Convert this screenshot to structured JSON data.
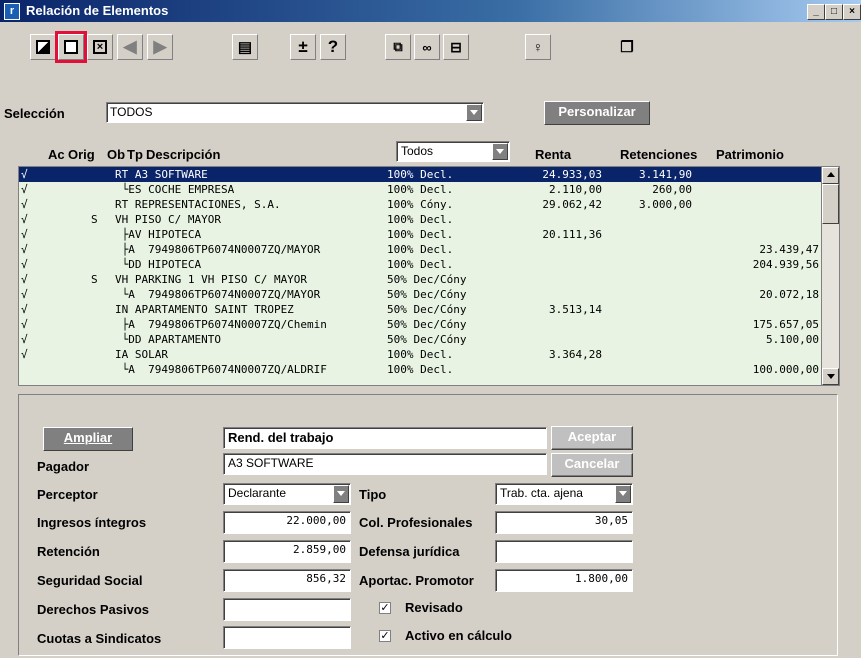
{
  "window": {
    "title": "Relación de Elementos",
    "app_icon_letter": "r",
    "controls": [
      "_",
      "□",
      "×"
    ]
  },
  "selection": {
    "label": "Selección",
    "value": "TODOS",
    "personalizar": "Personalizar"
  },
  "filter": {
    "value": "Todos"
  },
  "columns": [
    "Ac",
    "Orig",
    "Ob",
    "Tp",
    "Descripción",
    "Renta",
    "Retenciones",
    "Patrimonio"
  ],
  "rows": [
    {
      "ac": "√",
      "ob": "",
      "desc": "RT A3 SOFTWARE",
      "tipo": "100% Decl.",
      "renta": "24.933,03",
      "ret": "3.141,90",
      "pat": "",
      "selected": true
    },
    {
      "ac": "√",
      "ob": "",
      "desc": " └ES COCHE EMPRESA",
      "tipo": "100% Decl.",
      "renta": "2.110,00",
      "ret": "260,00",
      "pat": ""
    },
    {
      "ac": "√",
      "ob": "",
      "desc": "RT REPRESENTACIONES, S.A.",
      "tipo": "100% Cóny.",
      "renta": "29.062,42",
      "ret": "3.000,00",
      "pat": ""
    },
    {
      "ac": "√",
      "ob": "S",
      "desc": "VH PISO C/ MAYOR",
      "tipo": "100% Decl.",
      "renta": "",
      "ret": "",
      "pat": ""
    },
    {
      "ac": "√",
      "ob": "",
      "desc": " ├AV HIPOTECA",
      "tipo": "100% Decl.",
      "renta": "20.111,36",
      "ret": "",
      "pat": ""
    },
    {
      "ac": "√",
      "ob": "",
      "desc": " ├A  7949806TP6074N0007ZQ/MAYOR",
      "tipo": "100% Decl.",
      "renta": "",
      "ret": "",
      "pat": "23.439,47"
    },
    {
      "ac": "√",
      "ob": "",
      "desc": " └DD HIPOTECA",
      "tipo": "100% Decl.",
      "renta": "",
      "ret": "",
      "pat": "204.939,56"
    },
    {
      "ac": "√",
      "ob": "S",
      "desc": "VH PARKING 1 VH PISO C/ MAYOR",
      "tipo": "50% Dec/Cóny",
      "renta": "",
      "ret": "",
      "pat": ""
    },
    {
      "ac": "√",
      "ob": "",
      "desc": " └A  7949806TP6074N0007ZQ/MAYOR",
      "tipo": "50% Dec/Cóny",
      "renta": "",
      "ret": "",
      "pat": "20.072,18"
    },
    {
      "ac": "√",
      "ob": "",
      "desc": "IN APARTAMENTO SAINT TROPEZ",
      "tipo": "50% Dec/Cóny",
      "renta": "3.513,14",
      "ret": "",
      "pat": ""
    },
    {
      "ac": "√",
      "ob": "",
      "desc": " ├A  7949806TP6074N0007ZQ/Chemin",
      "tipo": "50% Dec/Cóny",
      "renta": "",
      "ret": "",
      "pat": "175.657,05"
    },
    {
      "ac": "√",
      "ob": "",
      "desc": " └DD APARTAMENTO",
      "tipo": "50% Dec/Cóny",
      "renta": "",
      "ret": "",
      "pat": "5.100,00"
    },
    {
      "ac": "√",
      "ob": "",
      "desc": "IA SOLAR",
      "tipo": "100% Decl.",
      "renta": "3.364,28",
      "ret": "",
      "pat": ""
    },
    {
      "ac": "",
      "ob": "",
      "desc": " └A  7949806TP6074N0007ZQ/ALDRIF",
      "tipo": "100% Decl.",
      "renta": "",
      "ret": "",
      "pat": "100.000,00"
    }
  ],
  "detail": {
    "ampliar": "Ampliar",
    "category": "Rend. del trabajo",
    "aceptar": "Aceptar",
    "cancelar": "Cancelar",
    "pagador_label": "Pagador",
    "pagador": "A3 SOFTWARE",
    "perceptor_label": "Perceptor",
    "perceptor": "Declarante",
    "tipo_label": "Tipo",
    "tipo": "Trab. cta. ajena",
    "ingresos_label": "Ingresos íntegros",
    "ingresos": "22.000,00",
    "retencion_label": "Retención",
    "retencion": "2.859,00",
    "ss_label": "Seguridad Social",
    "ss": "856,32",
    "derechos_label": "Derechos Pasivos",
    "derechos": "",
    "cuotas_label": "Cuotas a Sindicatos",
    "cuotas": "",
    "colprof_label": "Col. Profesionales",
    "colprof": "30,05",
    "defensa_label": "Defensa jurídica",
    "defensa": "",
    "aportac_label": "Aportac. Promotor",
    "aportac": "1.800,00",
    "revisado_label": "Revisado",
    "activo_label": "Activo en cálculo"
  }
}
